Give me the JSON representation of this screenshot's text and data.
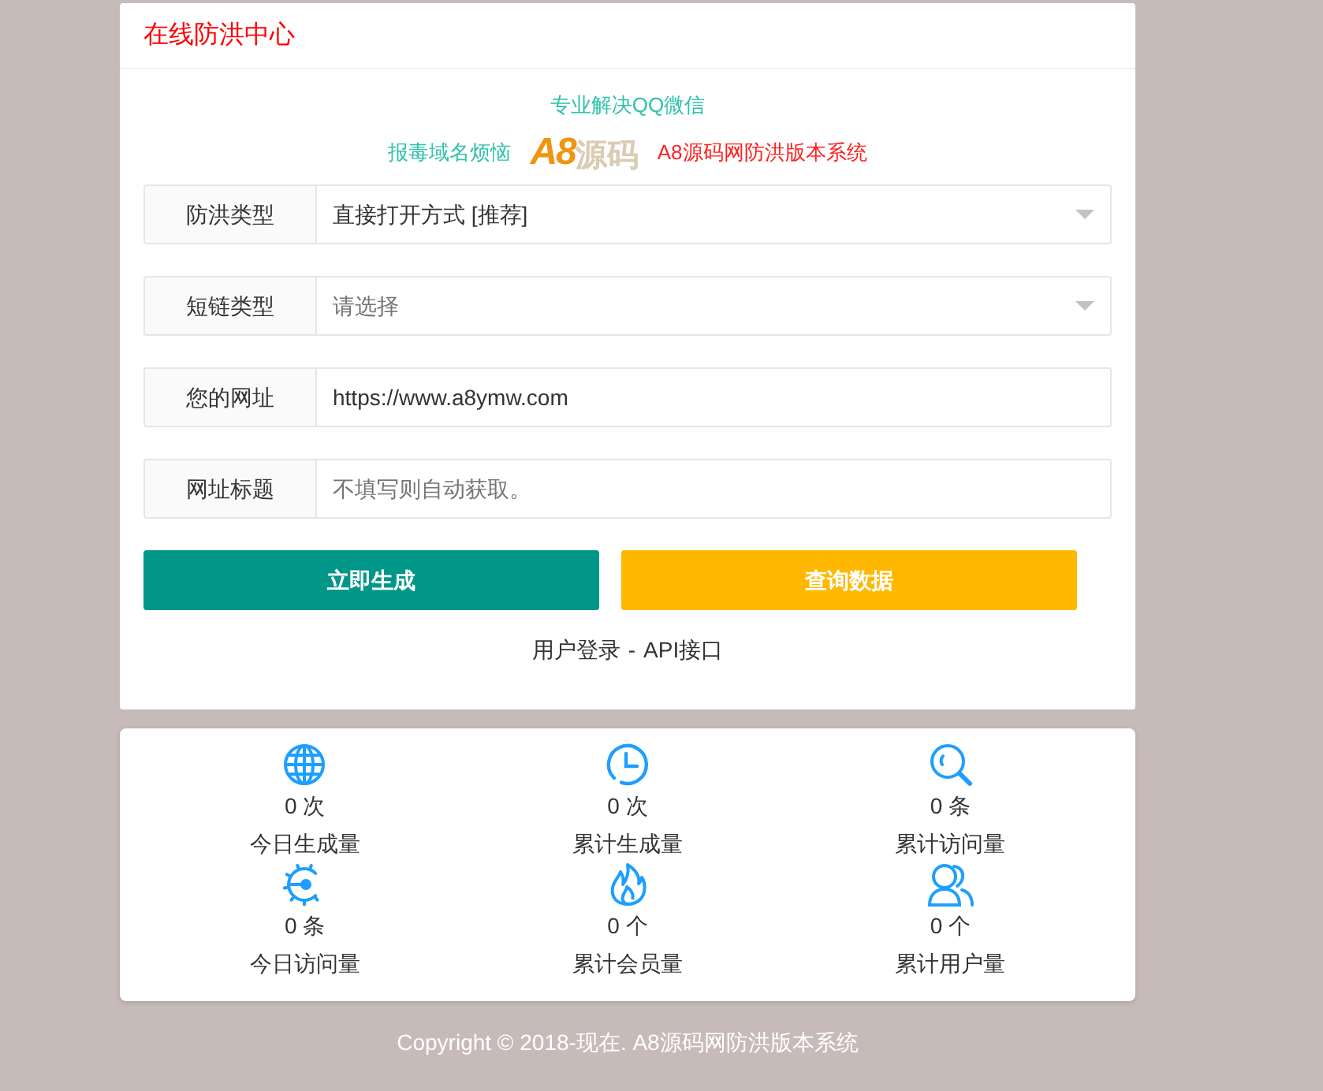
{
  "header": {
    "title": "在线防洪中心"
  },
  "slogan": {
    "line_1": "专业解决QQ微信",
    "line_2_left": "报毒域名烦恼",
    "logo": {
      "mark": "A8",
      "word": "源码"
    },
    "line_2_right": "A8源码网防洪版本系统"
  },
  "form": {
    "fields": [
      {
        "kind": "select",
        "label": "防洪类型",
        "value": "直接打开方式 [推荐]"
      },
      {
        "kind": "select",
        "label": "短链类型",
        "placeholder": "请选择"
      },
      {
        "kind": "text",
        "label": "您的网址",
        "value": "https://www.a8ymw.com"
      },
      {
        "kind": "text",
        "label": "网址标题",
        "placeholder": "不填写则自动获取。"
      }
    ]
  },
  "buttons": [
    {
      "label": "立即生成",
      "color": "#009688"
    },
    {
      "label": "查询数据",
      "color": "#ffb800"
    }
  ],
  "links": {
    "items": [
      "用户登录",
      "API接口"
    ],
    "separator": "-"
  },
  "stats": [
    {
      "value": "0 次",
      "label": "今日生成量"
    },
    {
      "value": "0 次",
      "label": "累计生成量"
    },
    {
      "value": "0 条",
      "label": "累计访问量"
    },
    {
      "value": "0 条",
      "label": "今日访问量"
    },
    {
      "value": "0 个",
      "label": "累计会员量"
    },
    {
      "value": "0 个",
      "label": "累计用户量"
    }
  ],
  "footer": {
    "text": "Copyright © 2018-现在. A8源码网防洪版本系统"
  }
}
